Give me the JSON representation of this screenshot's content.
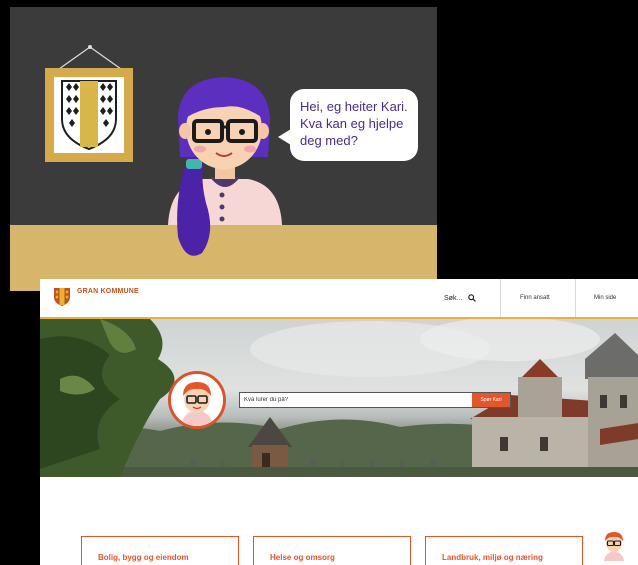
{
  "illustration": {
    "speech_bubble": {
      "lines": [
        "Hei, eg heiter Kari.",
        "Kva kan eg hjelpe",
        "deg med?"
      ]
    },
    "icons": [
      "coat-of-arms-icon",
      "kari-character-icon"
    ]
  },
  "website": {
    "logo_text": "GRAN KOMMUNE",
    "header": {
      "search_label": "Søk...",
      "nav": [
        "Finn ansatt",
        "Min side"
      ]
    },
    "hero": {
      "search_placeholder": "Kva lurer du på?",
      "ask_button": "Spør Kari"
    },
    "categories": [
      "Bolig, bygg og eiendom",
      "Helse og omsorg",
      "Landbruk, miljø og næring"
    ]
  },
  "colors": {
    "brand_orange": "#e2572a",
    "accent_gold": "#e9b233",
    "floor": "#d6b66b",
    "bubble_text": "#4a2c83"
  }
}
